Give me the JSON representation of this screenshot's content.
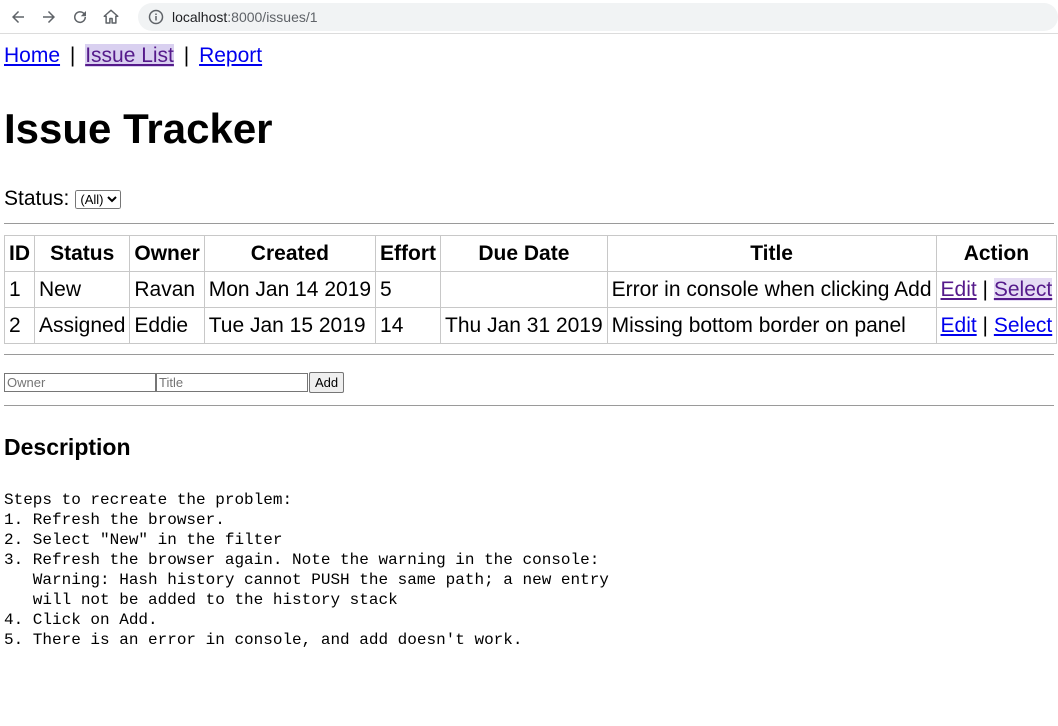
{
  "browser": {
    "url_host": "localhost",
    "url_rest": ":8000/issues/1"
  },
  "nav": {
    "home": "Home",
    "sep1": "|",
    "issue_list": "Issue List",
    "sep2": "|",
    "report": "Report"
  },
  "title": "Issue Tracker",
  "filter": {
    "label": "Status:",
    "selected": "(All)"
  },
  "table": {
    "headers": [
      "ID",
      "Status",
      "Owner",
      "Created",
      "Effort",
      "Due Date",
      "Title",
      "Action"
    ],
    "rows": [
      {
        "id": "1",
        "status": "New",
        "owner": "Ravan",
        "created": "Mon Jan 14 2019",
        "effort": "5",
        "due": "",
        "title": "Error in console when clicking Add",
        "edit": "Edit",
        "sep": "|",
        "select": "Select"
      },
      {
        "id": "2",
        "status": "Assigned",
        "owner": "Eddie",
        "created": "Tue Jan 15 2019",
        "effort": "14",
        "due": "Thu Jan 31 2019",
        "title": "Missing bottom border on panel",
        "edit": "Edit",
        "sep": "|",
        "select": "Select"
      }
    ]
  },
  "add_form": {
    "owner_placeholder": "Owner",
    "title_placeholder": "Title",
    "add_label": "Add"
  },
  "description": {
    "heading": "Description",
    "text": "Steps to recreate the problem:\n1. Refresh the browser.\n2. Select \"New\" in the filter\n3. Refresh the browser again. Note the warning in the console:\n   Warning: Hash history cannot PUSH the same path; a new entry\n   will not be added to the history stack\n4. Click on Add.\n5. There is an error in console, and add doesn't work."
  }
}
